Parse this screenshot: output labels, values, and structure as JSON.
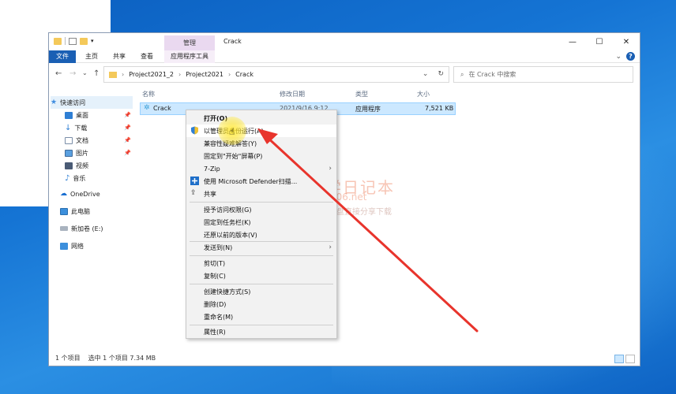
{
  "window": {
    "title": "Crack",
    "context_tab_top": "管理",
    "controls": {
      "minimize": "—",
      "maximize": "☐",
      "close": "✕"
    }
  },
  "ribbon": {
    "tabs": [
      "文件",
      "主页",
      "共享",
      "查看"
    ],
    "context_tab": "应用程序工具"
  },
  "nav": {
    "back": "←",
    "forward": "→",
    "history": "⌄",
    "up": "↑",
    "breadcrumb": [
      "Project2021_2",
      "Project2021",
      "Crack"
    ],
    "refresh": "↻",
    "dropdown": "⌄",
    "search_placeholder": "在 Crack 中搜索"
  },
  "sidebar": {
    "items": [
      {
        "label": "快速访问",
        "icon": "star-icon"
      },
      {
        "label": "桌面",
        "icon": "desktop-icon"
      },
      {
        "label": "下载",
        "icon": "download-icon"
      },
      {
        "label": "文档",
        "icon": "document-icon"
      },
      {
        "label": "图片",
        "icon": "pictures-icon"
      },
      {
        "label": "视频",
        "icon": "video-icon"
      },
      {
        "label": "音乐",
        "icon": "music-icon"
      },
      {
        "label": "OneDrive",
        "icon": "cloud-icon"
      },
      {
        "label": "此电脑",
        "icon": "computer-icon"
      },
      {
        "label": "新加卷 (E:)",
        "icon": "drive-icon"
      },
      {
        "label": "网络",
        "icon": "network-icon"
      }
    ]
  },
  "columns": {
    "name": "名称",
    "date": "修改日期",
    "type": "类型",
    "size": "大小"
  },
  "file": {
    "name": "Crack",
    "date": "2021/9/16 9:12",
    "type": "应用程序",
    "size": "7,521 KB"
  },
  "status": {
    "count": "1 个项目",
    "selected": "选中 1 个项目 7.34 MB"
  },
  "context_menu": {
    "items": [
      "打开(O)",
      "以管理员身份运行(A)",
      "兼容性疑难解答(Y)",
      "固定到\"开始\"屏幕(P)",
      "7-Zip",
      "使用 Microsoft Defender扫描...",
      "共享",
      "授予访问权限(G)",
      "固定到任务栏(K)",
      "还原以前的版本(V)",
      "发送到(N)",
      "剪切(T)",
      "复制(C)",
      "创建快捷方式(S)",
      "删除(D)",
      "重命名(M)",
      "属性(R)"
    ]
  },
  "watermark": {
    "line1": "丁同学日记本",
    "line2": "www.ds006.net",
    "line3": "软件、资源、资料网盘直接分享下载"
  },
  "colors": {
    "accent": "#1a5fb4",
    "selection": "#cce8ff",
    "arrow": "#e8342c",
    "cursor_glow": "#ffe628"
  }
}
